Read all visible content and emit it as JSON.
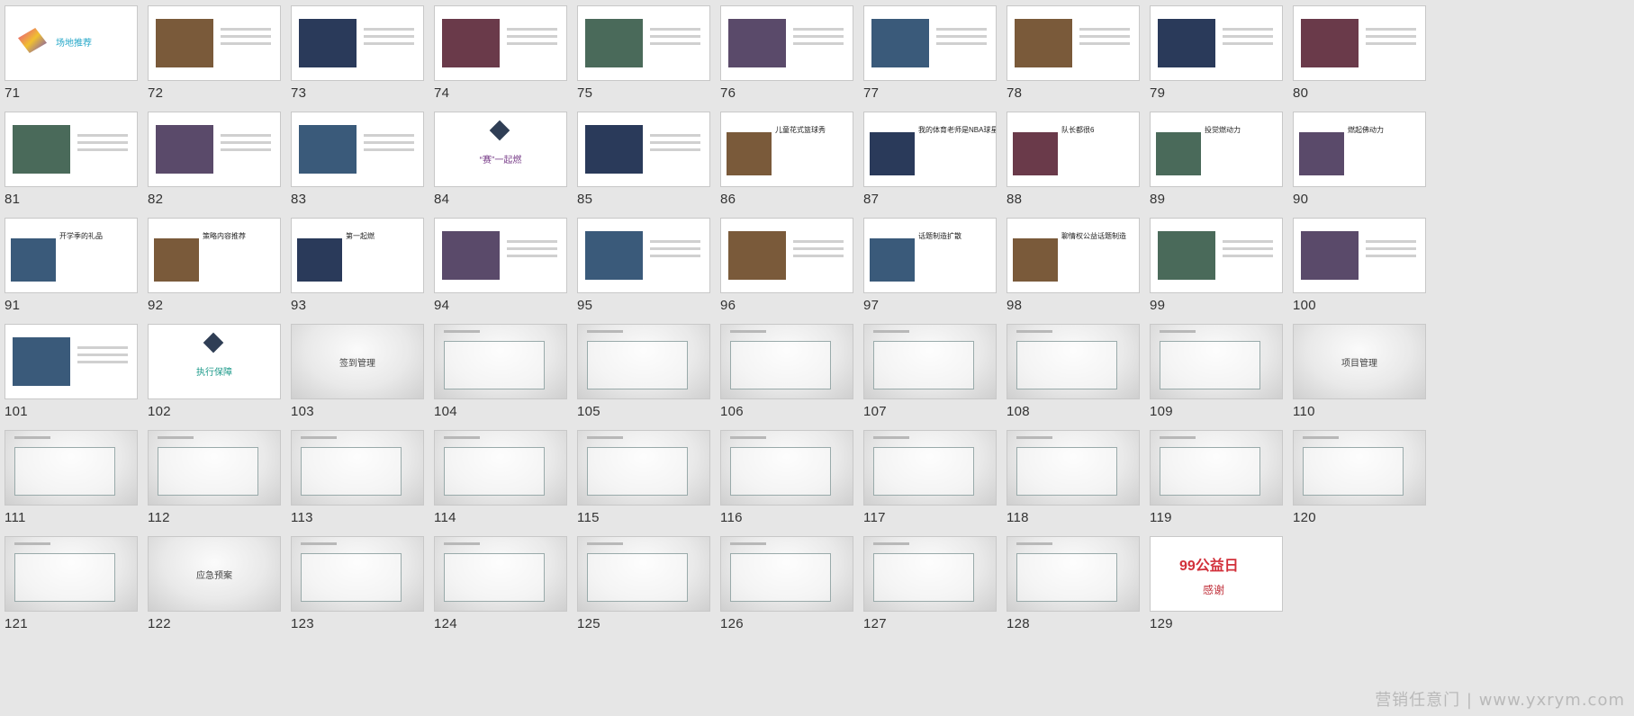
{
  "slides": [
    {
      "num": "71",
      "style": "white",
      "title": "场地推荐"
    },
    {
      "num": "72",
      "style": "white",
      "title": ""
    },
    {
      "num": "73",
      "style": "white",
      "title": ""
    },
    {
      "num": "74",
      "style": "white",
      "title": ""
    },
    {
      "num": "75",
      "style": "white",
      "title": ""
    },
    {
      "num": "76",
      "style": "white",
      "title": ""
    },
    {
      "num": "77",
      "style": "white",
      "title": ""
    },
    {
      "num": "78",
      "style": "white",
      "title": ""
    },
    {
      "num": "79",
      "style": "white",
      "title": ""
    },
    {
      "num": "80",
      "style": "white",
      "title": ""
    },
    {
      "num": "81",
      "style": "white",
      "title": ""
    },
    {
      "num": "82",
      "style": "white",
      "title": ""
    },
    {
      "num": "83",
      "style": "white",
      "title": ""
    },
    {
      "num": "84",
      "style": "white",
      "title": "“赛”一起燃"
    },
    {
      "num": "85",
      "style": "white",
      "title": ""
    },
    {
      "num": "86",
      "style": "white",
      "title": "儿童花式篮球秀"
    },
    {
      "num": "87",
      "style": "white",
      "title": "我的体育老师是NBA球星"
    },
    {
      "num": "88",
      "style": "white",
      "title": "队长都很6"
    },
    {
      "num": "89",
      "style": "white",
      "title": "投觉燃动力"
    },
    {
      "num": "90",
      "style": "white",
      "title": "燃起佛动力"
    },
    {
      "num": "91",
      "style": "white",
      "title": "开学季的礼品"
    },
    {
      "num": "92",
      "style": "white",
      "title": "策略内容推荐"
    },
    {
      "num": "93",
      "style": "white",
      "title": "第一起燃"
    },
    {
      "num": "94",
      "style": "white",
      "title": ""
    },
    {
      "num": "95",
      "style": "white",
      "title": ""
    },
    {
      "num": "96",
      "style": "white",
      "title": ""
    },
    {
      "num": "97",
      "style": "white",
      "title": "话题制造扩散"
    },
    {
      "num": "98",
      "style": "white",
      "title": "聊情权公益话题制造"
    },
    {
      "num": "99",
      "style": "white",
      "title": ""
    },
    {
      "num": "100",
      "style": "white",
      "title": ""
    },
    {
      "num": "101",
      "style": "white",
      "title": ""
    },
    {
      "num": "102",
      "style": "white",
      "title": "执行保障"
    },
    {
      "num": "103",
      "style": "grey",
      "title": "签到管理"
    },
    {
      "num": "104",
      "style": "grey",
      "title": ""
    },
    {
      "num": "105",
      "style": "grey",
      "title": ""
    },
    {
      "num": "106",
      "style": "grey",
      "title": ""
    },
    {
      "num": "107",
      "style": "grey",
      "title": ""
    },
    {
      "num": "108",
      "style": "grey",
      "title": ""
    },
    {
      "num": "109",
      "style": "grey",
      "title": ""
    },
    {
      "num": "110",
      "style": "grey",
      "title": "项目管理"
    },
    {
      "num": "111",
      "style": "grey",
      "title": ""
    },
    {
      "num": "112",
      "style": "grey",
      "title": ""
    },
    {
      "num": "113",
      "style": "grey",
      "title": ""
    },
    {
      "num": "114",
      "style": "grey",
      "title": ""
    },
    {
      "num": "115",
      "style": "grey",
      "title": ""
    },
    {
      "num": "116",
      "style": "grey",
      "title": ""
    },
    {
      "num": "117",
      "style": "grey",
      "title": ""
    },
    {
      "num": "118",
      "style": "grey",
      "title": ""
    },
    {
      "num": "119",
      "style": "grey",
      "title": ""
    },
    {
      "num": "120",
      "style": "grey",
      "title": ""
    },
    {
      "num": "121",
      "style": "grey",
      "title": ""
    },
    {
      "num": "122",
      "style": "grey",
      "title": "应急预案"
    },
    {
      "num": "123",
      "style": "grey",
      "title": ""
    },
    {
      "num": "124",
      "style": "grey",
      "title": ""
    },
    {
      "num": "125",
      "style": "grey",
      "title": ""
    },
    {
      "num": "126",
      "style": "grey",
      "title": ""
    },
    {
      "num": "127",
      "style": "grey",
      "title": ""
    },
    {
      "num": "128",
      "style": "grey",
      "title": ""
    },
    {
      "num": "129",
      "style": "white",
      "title": "99公益日"
    }
  ],
  "end_slide": {
    "logo_text": "99公益日",
    "thanks": "感谢"
  },
  "watermark": "营销任意门 | www.yxrym.com"
}
